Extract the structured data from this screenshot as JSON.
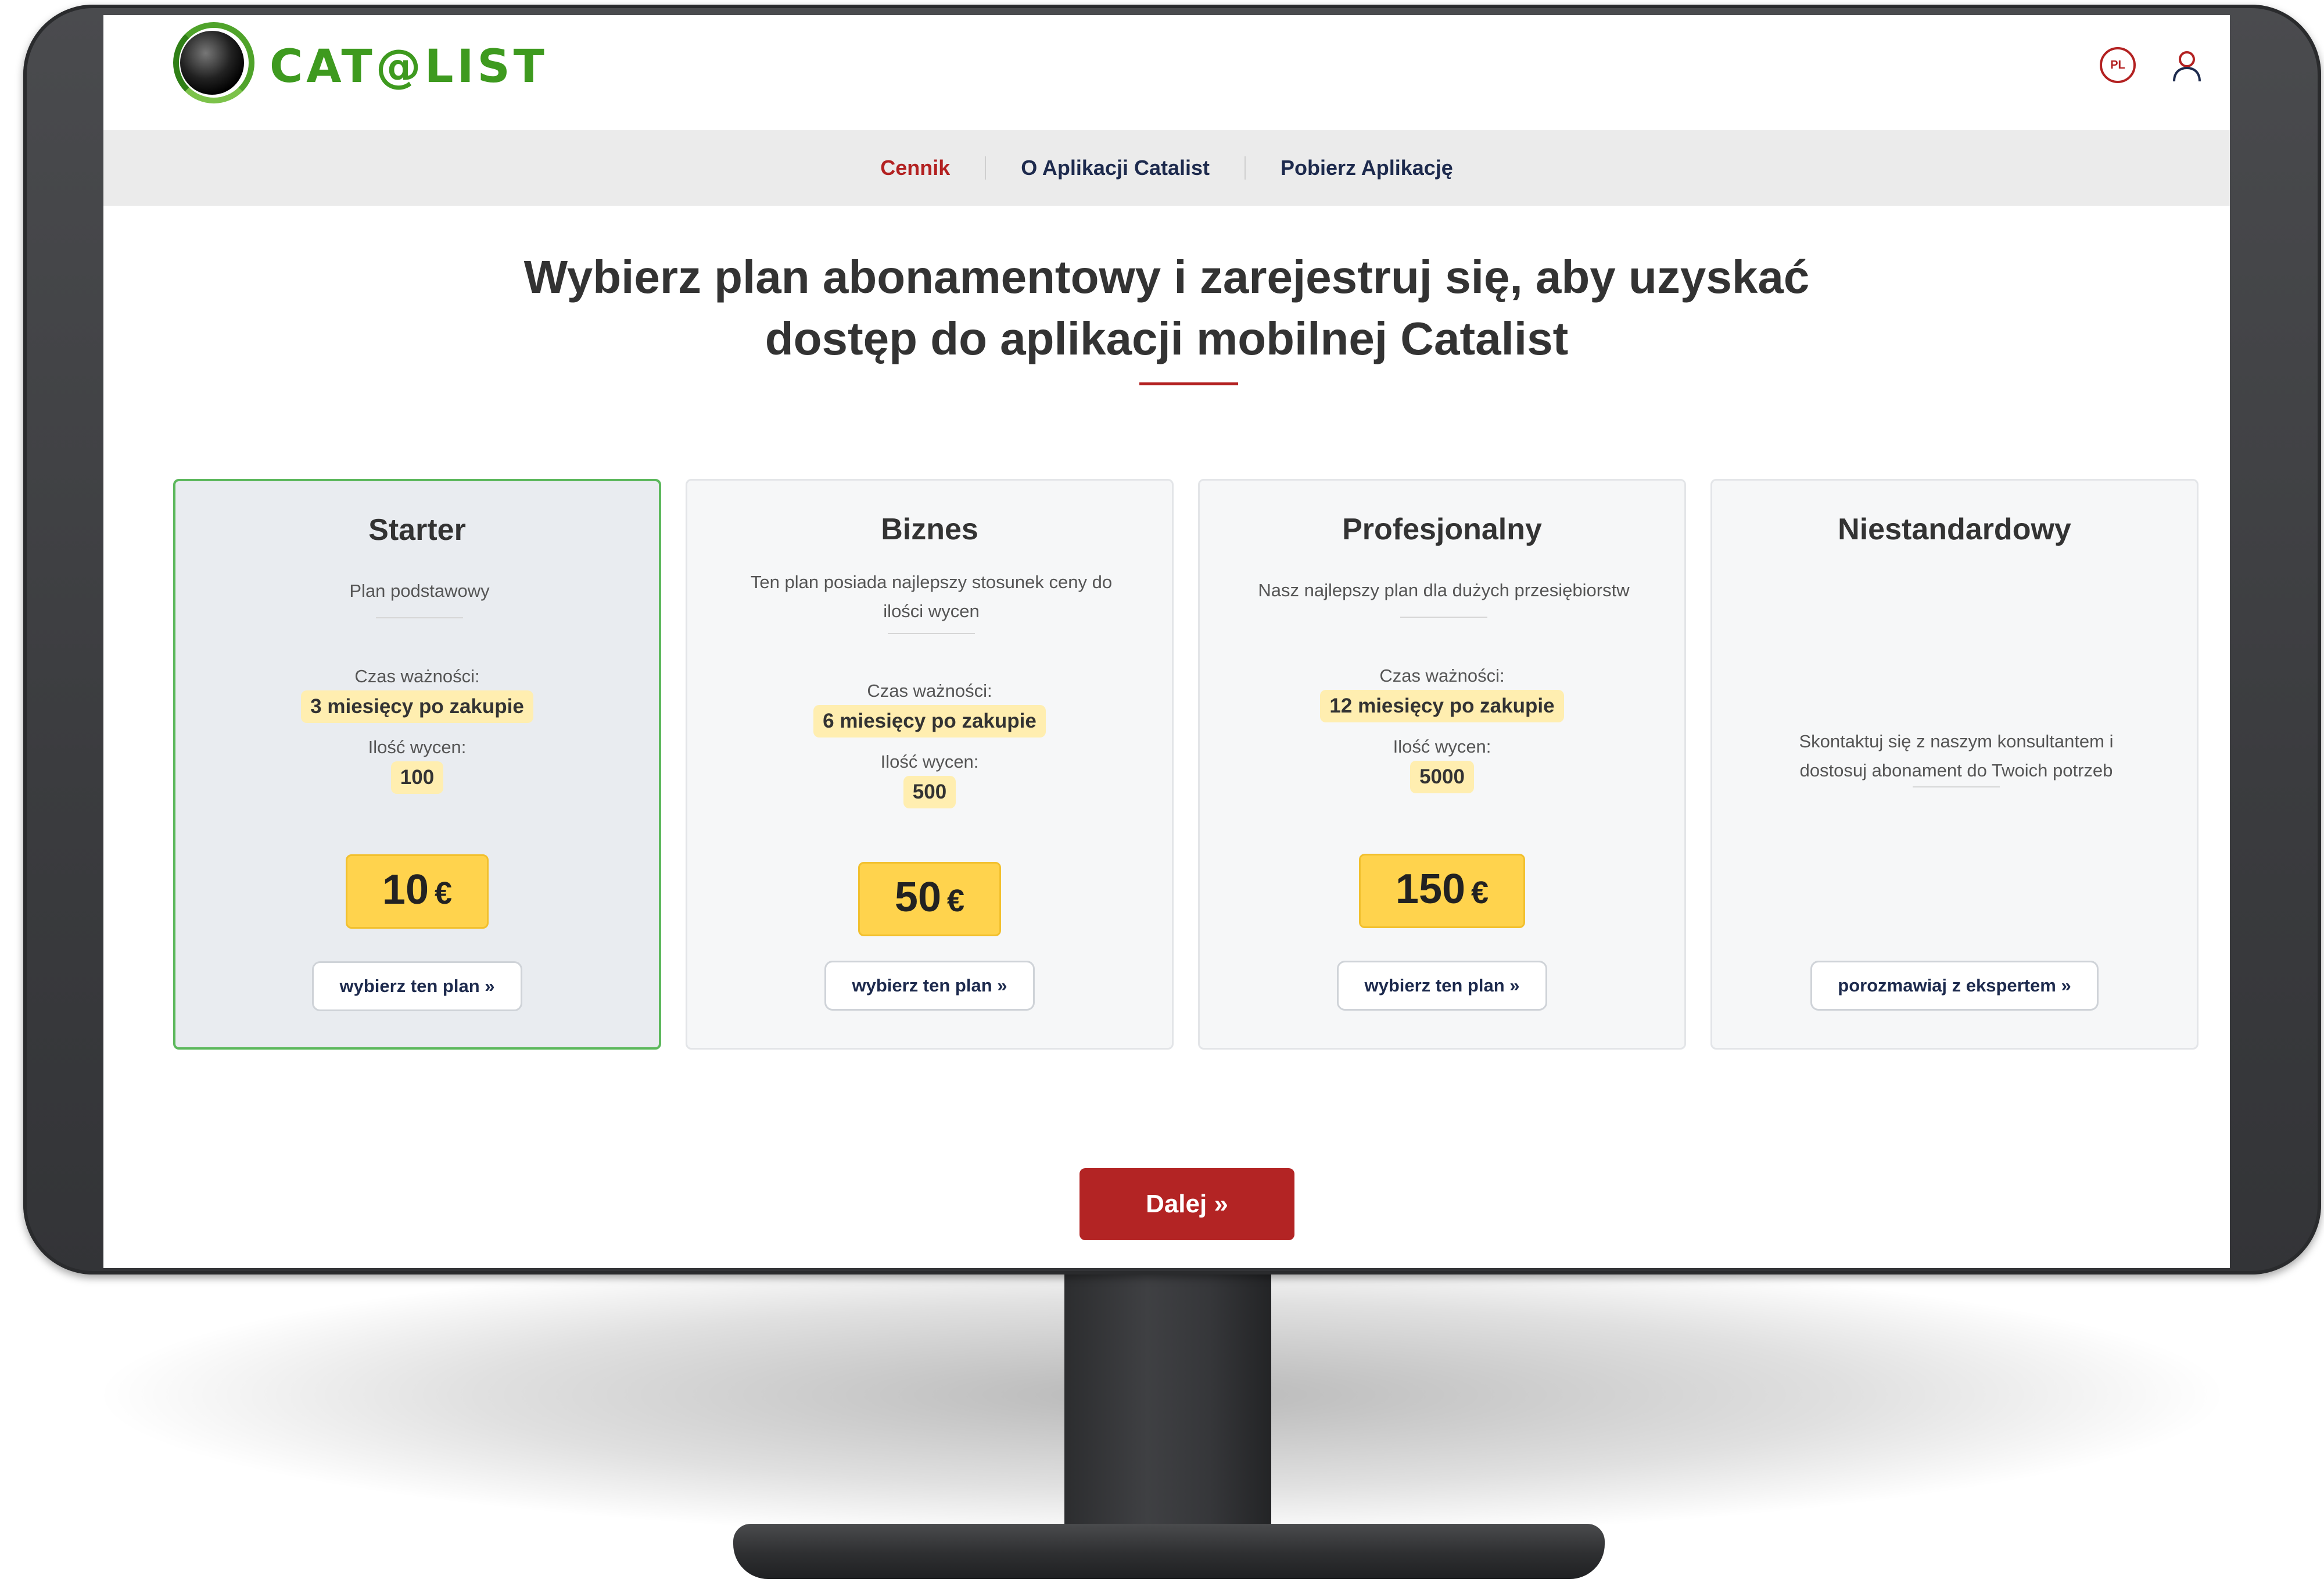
{
  "header": {
    "logo_text": "CAT@LIST",
    "language": "PL"
  },
  "nav": {
    "items": [
      {
        "label": "Cennik",
        "active": true
      },
      {
        "label": "O Aplikacji Catalist",
        "active": false
      },
      {
        "label": "Pobierz Aplikację",
        "active": false
      }
    ]
  },
  "main": {
    "headline_line1": "Wybierz plan abonamentowy i zarejestruj się, aby uzyskać",
    "headline_line2": "dostęp do aplikacji mobilnej Catalist",
    "next_label": "Dalej »"
  },
  "plans": [
    {
      "title": "Starter",
      "description": "Plan podstawowy",
      "validity_label": "Czas ważności:",
      "validity": "3 miesięcy po zakupie",
      "quota_label": "Ilość wycen:",
      "quota": "100",
      "price": "10",
      "currency": "€",
      "button": "wybierz ten plan »"
    },
    {
      "title": "Biznes",
      "description": "Ten plan posiada najlepszy stosunek ceny do ilości wycen",
      "validity_label": "Czas ważności:",
      "validity": "6 miesięcy po zakupie",
      "quota_label": "Ilość wycen:",
      "quota": "500",
      "price": "50",
      "currency": "€",
      "button": "wybierz ten plan »"
    },
    {
      "title": "Profesjonalny",
      "description": "Nasz najlepszy plan dla dużych przesiębiorstw",
      "validity_label": "Czas ważności:",
      "validity": "12 miesięcy po zakupie",
      "quota_label": "Ilość wycen:",
      "quota": "5000",
      "price": "150",
      "currency": "€",
      "button": "wybierz ten plan »"
    },
    {
      "title": "Niestandardowy",
      "description": "Skontaktuj się z naszym konsultantem i dostosuj abonament do Twoich potrzeb",
      "button": "porozmawiaj z ekspertem »"
    }
  ],
  "colors": {
    "brand_green": "#3e9a1f",
    "accent_red": "#b32121",
    "price_yellow": "#ffd34d",
    "pill_yellow": "#ffeeb0",
    "selected_border": "#5cb85c"
  },
  "selected_plan": "Starter"
}
